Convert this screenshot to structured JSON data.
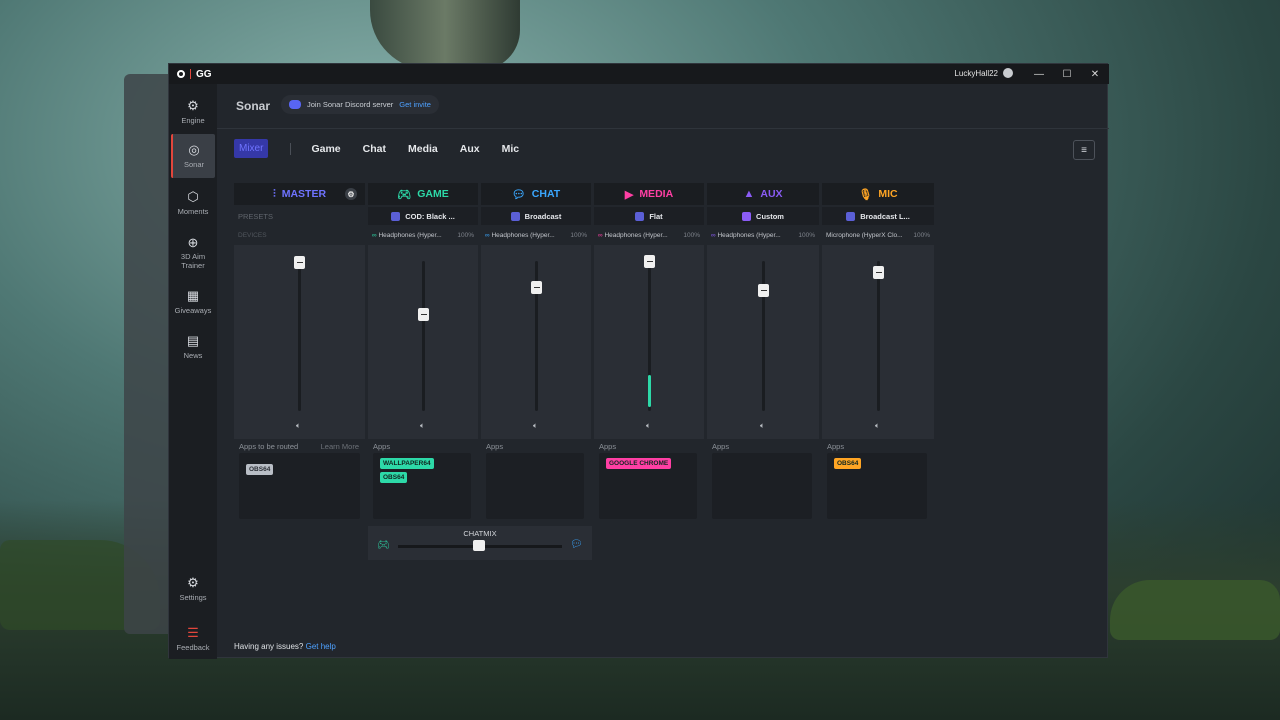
{
  "app": {
    "logo": "GG",
    "user": "LuckyHall22"
  },
  "window_controls": [
    "—",
    "☐",
    "✕"
  ],
  "sidebar": {
    "items": [
      {
        "label": "Engine",
        "icon": "chip-icon",
        "glyph": "⚙"
      },
      {
        "label": "Sonar",
        "icon": "sonar-icon",
        "glyph": "◎",
        "active": true
      },
      {
        "label": "Moments",
        "icon": "hexagon-icon",
        "glyph": "⬡"
      },
      {
        "label": "3D Aim Trainer",
        "icon": "crosshair-icon",
        "glyph": "⊕"
      },
      {
        "label": "Giveaways",
        "icon": "gift-icon",
        "glyph": "▦"
      },
      {
        "label": "News",
        "icon": "book-icon",
        "glyph": "▤"
      }
    ],
    "bottom": [
      {
        "label": "Settings",
        "icon": "gear-icon",
        "glyph": "⚙"
      },
      {
        "label": "Feedback",
        "icon": "feedback-icon",
        "glyph": "☰"
      }
    ]
  },
  "header": {
    "title": "Sonar",
    "discord_text": "Join Sonar Discord server",
    "discord_link": "Get invite"
  },
  "tabs": [
    "Mixer",
    "Game",
    "Chat",
    "Media",
    "Aux",
    "Mic"
  ],
  "master": {
    "title": "MASTER",
    "presets_label": "PRESETS",
    "devices_label": "DEVICES",
    "apps_label": "Apps to be routed",
    "learn_more": "Learn More",
    "apps": [
      "OBS64"
    ]
  },
  "channels": [
    {
      "title": "GAME",
      "color": "#2dd9a8",
      "icon": "gamepad-icon",
      "preset": "COD: Black ...",
      "device": "Headphones (Hyper...",
      "pct": "100%",
      "apps": [
        "WALLPAPER64",
        "OBS64"
      ],
      "chip_color": "#2dd9a8",
      "level": 0.65
    },
    {
      "title": "CHAT",
      "color": "#3aa7ff",
      "icon": "chat-icon",
      "preset": "Broadcast",
      "device": "Headphones (Hyper...",
      "pct": "100%",
      "apps": [],
      "level": 0.83
    },
    {
      "title": "MEDIA",
      "color": "#ff3fa4",
      "icon": "play-icon",
      "preset": "Flat",
      "device": "Headphones (Hyper...",
      "pct": "100%",
      "apps": [
        "GOOGLE CHROME"
      ],
      "chip_color": "#ff3fa4",
      "level": 1.0
    },
    {
      "title": "AUX",
      "color": "#8b5cf6",
      "icon": "shapes-icon",
      "preset": "Custom",
      "device": "Headphones (Hyper...",
      "pct": "100%",
      "apps": [],
      "level": 0.81
    },
    {
      "title": "MIC",
      "color": "#ffa524",
      "icon": "mic-icon",
      "preset": "Broadcast L...",
      "device": "Microphone (HyperX Clo...",
      "pct": "100%",
      "apps": [
        "OBS64"
      ],
      "chip_color": "#ffa524",
      "level": 0.93
    }
  ],
  "apps_label": "Apps",
  "chatmix": {
    "label": "CHATMIX",
    "value": 0.5
  },
  "footer": {
    "text": "Having any issues?",
    "link": "Get help"
  }
}
